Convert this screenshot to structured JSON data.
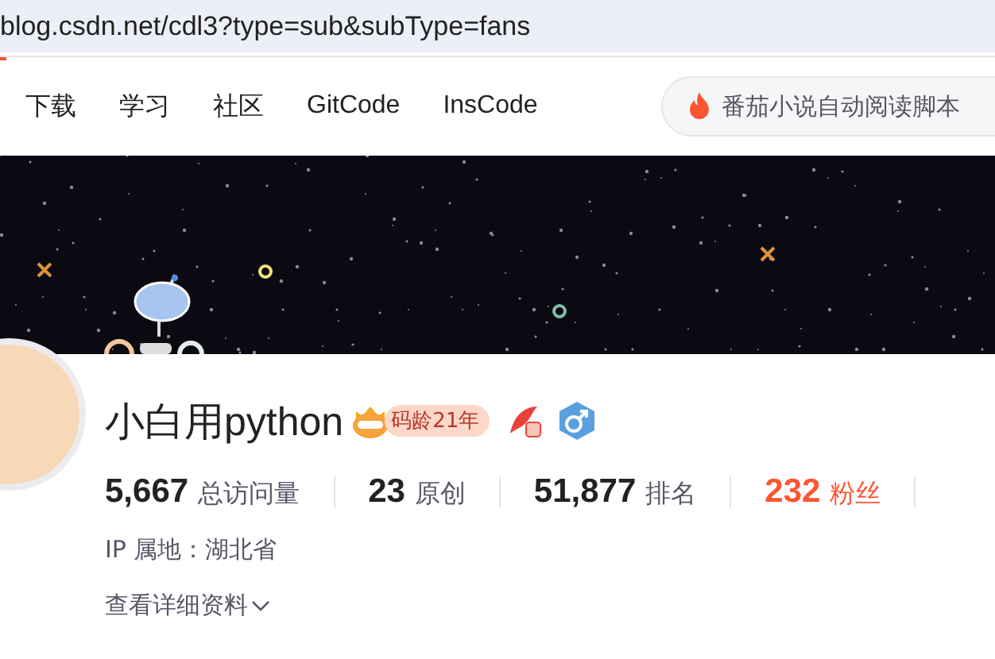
{
  "address_bar": {
    "url": "blog.csdn.net/cdl3?type=sub&subType=fans"
  },
  "nav": {
    "items": [
      "下载",
      "学习",
      "社区",
      "GitCode",
      "InsCode"
    ],
    "search": {
      "value": "番茄小说自动阅读脚本"
    }
  },
  "profile": {
    "name": "小白用python",
    "badge": "码龄21年",
    "stats": [
      {
        "value": "5,667",
        "label": "总访问量",
        "selected": false
      },
      {
        "value": "23",
        "label": "原创",
        "selected": false
      },
      {
        "value": "51,877",
        "label": "排名",
        "selected": false
      },
      {
        "value": "232",
        "label": "粉丝",
        "selected": true
      }
    ],
    "ip": "IP 属地：湖北省",
    "details_link": "查看详细资料"
  }
}
